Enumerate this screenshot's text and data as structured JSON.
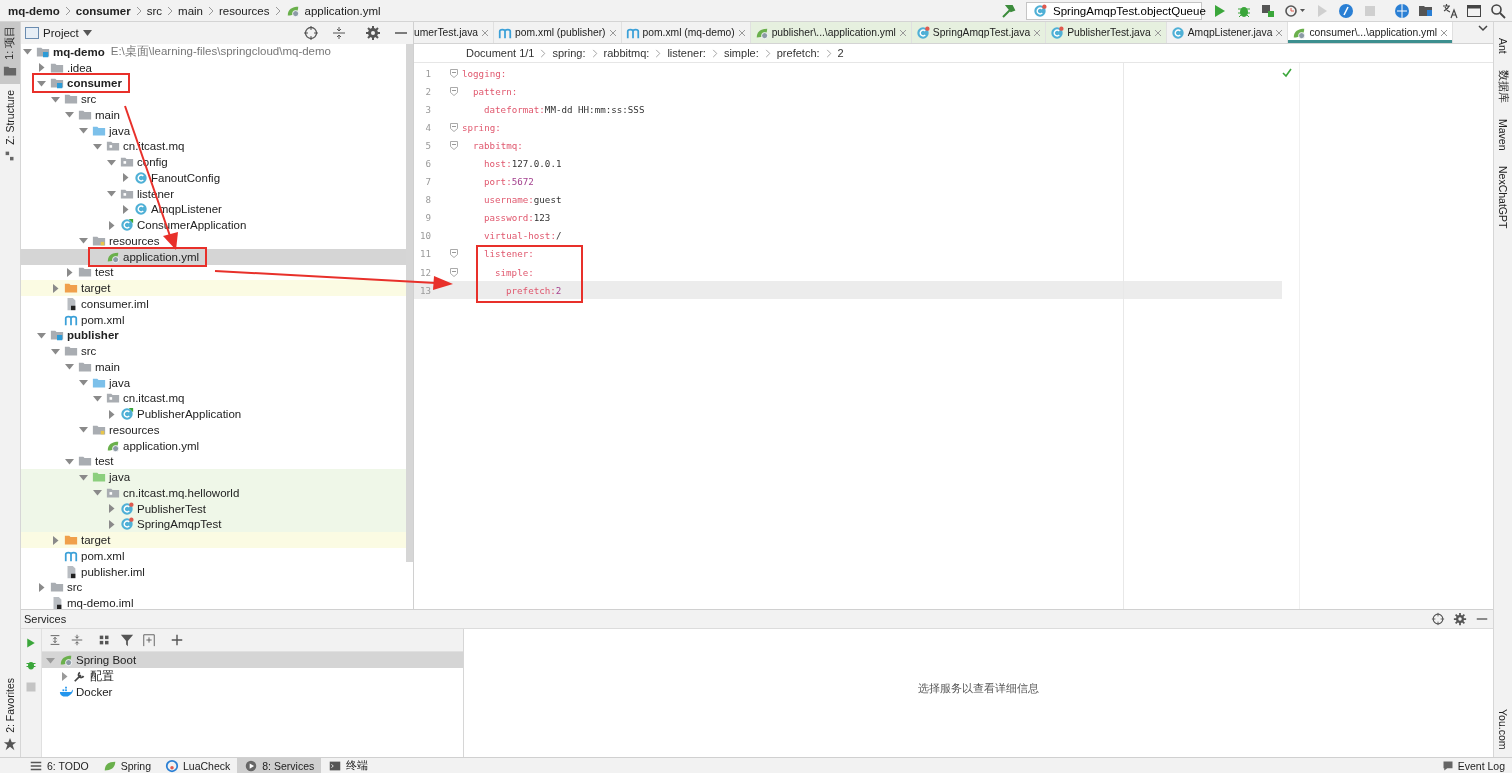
{
  "breadcrumbs": [
    {
      "label": "mq-demo",
      "kind": "module"
    },
    {
      "label": "consumer",
      "kind": "module"
    },
    {
      "label": "src",
      "kind": "folder"
    },
    {
      "label": "main",
      "kind": "folder"
    },
    {
      "label": "resources",
      "kind": "folder"
    },
    {
      "label": "application.yml",
      "kind": "file"
    }
  ],
  "run_config": {
    "label": "SpringAmqpTest.objectQueue"
  },
  "left_tool_tabs": [
    {
      "label": "1: 项目",
      "selected": true
    },
    {
      "label": "Z: Structure",
      "selected": false
    }
  ],
  "left_bottom_tool_tabs": [
    {
      "label": "2: Favorites",
      "selected": false
    }
  ],
  "right_tool_tabs": [
    {
      "label": "Ant"
    },
    {
      "label": "数据库"
    },
    {
      "label": "Maven"
    },
    {
      "label": "NexChatGPT"
    }
  ],
  "right_bottom_tool_tabs": [
    {
      "label": "You.com"
    }
  ],
  "project": {
    "title": "Project",
    "tree": [
      {
        "label": "mq-demo",
        "path": "E:\\桌面\\learning-files\\springcloud\\mq-demo",
        "kind": "module",
        "expanded": true,
        "selected": false,
        "highlighted": false,
        "children": [
          {
            "label": ".idea",
            "kind": "folder",
            "expanded": false,
            "selected": false,
            "highlighted": false
          },
          {
            "label": "consumer",
            "kind": "module",
            "expanded": true,
            "selected": false,
            "highlighted": true,
            "children": [
              {
                "label": "src",
                "kind": "folder",
                "expanded": true,
                "selected": false,
                "highlighted": false,
                "children": [
                  {
                    "label": "main",
                    "kind": "folder",
                    "expanded": true,
                    "selected": false,
                    "highlighted": false,
                    "children": [
                      {
                        "label": "java",
                        "kind": "source-root",
                        "expanded": true,
                        "selected": false,
                        "highlighted": false,
                        "children": [
                          {
                            "label": "cn.itcast.mq",
                            "kind": "package",
                            "expanded": true,
                            "selected": false,
                            "highlighted": false,
                            "children": [
                              {
                                "label": "config",
                                "kind": "package",
                                "expanded": true,
                                "selected": false,
                                "highlighted": false,
                                "children": [
                                  {
                                    "label": "FanoutConfig",
                                    "kind": "class",
                                    "expanded": false,
                                    "selected": false,
                                    "highlighted": false
                                  }
                                ]
                              },
                              {
                                "label": "listener",
                                "kind": "package",
                                "expanded": true,
                                "selected": false,
                                "highlighted": false,
                                "children": [
                                  {
                                    "label": "AmqpListener",
                                    "kind": "class",
                                    "expanded": false,
                                    "selected": false,
                                    "highlighted": false
                                  }
                                ]
                              },
                              {
                                "label": "ConsumerApplication",
                                "kind": "app-class",
                                "expanded": false,
                                "selected": false,
                                "highlighted": false
                              }
                            ]
                          }
                        ]
                      },
                      {
                        "label": "resources",
                        "kind": "resources",
                        "expanded": true,
                        "selected": false,
                        "highlighted": false,
                        "children": [
                          {
                            "label": "application.yml",
                            "kind": "yml",
                            "selected": true,
                            "highlighted": true
                          }
                        ]
                      }
                    ]
                  },
                  {
                    "label": "test",
                    "kind": "folder",
                    "expanded": false,
                    "selected": false,
                    "highlighted": false
                  }
                ]
              },
              {
                "label": "target",
                "kind": "excluded",
                "expanded": false,
                "selected": false,
                "highlighted": false
              },
              {
                "label": "consumer.iml",
                "kind": "iml",
                "selected": false,
                "highlighted": false
              },
              {
                "label": "pom.xml",
                "kind": "pom",
                "selected": false,
                "highlighted": false
              }
            ]
          },
          {
            "label": "publisher",
            "kind": "module",
            "expanded": true,
            "selected": false,
            "highlighted": false,
            "children": [
              {
                "label": "src",
                "kind": "folder",
                "expanded": true,
                "selected": false,
                "highlighted": false,
                "children": [
                  {
                    "label": "main",
                    "kind": "folder",
                    "expanded": true,
                    "selected": false,
                    "highlighted": false,
                    "children": [
                      {
                        "label": "java",
                        "kind": "source-root",
                        "expanded": true,
                        "selected": false,
                        "highlighted": false,
                        "children": [
                          {
                            "label": "cn.itcast.mq",
                            "kind": "package",
                            "expanded": true,
                            "selected": false,
                            "highlighted": false,
                            "children": [
                              {
                                "label": "PublisherApplication",
                                "kind": "app-class",
                                "expanded": false,
                                "selected": false,
                                "highlighted": false
                              }
                            ]
                          }
                        ]
                      },
                      {
                        "label": "resources",
                        "kind": "resources",
                        "expanded": true,
                        "selected": false,
                        "highlighted": false,
                        "children": [
                          {
                            "label": "application.yml",
                            "kind": "yml",
                            "selected": false,
                            "highlighted": false
                          }
                        ]
                      }
                    ]
                  },
                  {
                    "label": "test",
                    "kind": "folder",
                    "expanded": true,
                    "selected": false,
                    "highlighted": false,
                    "children": [
                      {
                        "label": "java",
                        "kind": "test-root",
                        "expanded": true,
                        "selected": false,
                        "highlighted": false,
                        "children": [
                          {
                            "label": "cn.itcast.mq.helloworld",
                            "kind": "test-package",
                            "expanded": true,
                            "selected": false,
                            "highlighted": false,
                            "children": [
                              {
                                "label": "PublisherTest",
                                "kind": "test-class",
                                "expanded": false,
                                "selected": false,
                                "highlighted": false
                              },
                              {
                                "label": "SpringAmqpTest",
                                "kind": "test-class",
                                "expanded": false,
                                "selected": false,
                                "highlighted": false
                              }
                            ]
                          }
                        ]
                      }
                    ]
                  }
                ]
              },
              {
                "label": "target",
                "kind": "excluded",
                "expanded": false,
                "selected": false,
                "highlighted": false
              },
              {
                "label": "pom.xml",
                "kind": "pom",
                "selected": false,
                "highlighted": false
              },
              {
                "label": "publisher.iml",
                "kind": "iml",
                "selected": false,
                "highlighted": false
              }
            ]
          },
          {
            "label": "src",
            "kind": "folder",
            "expanded": false,
            "selected": false,
            "highlighted": false
          },
          {
            "label": "mq-demo.iml",
            "kind": "iml",
            "selected": false,
            "highlighted": false
          }
        ]
      }
    ]
  },
  "editor": {
    "tabs": [
      {
        "label": "umerTest.java",
        "kind": "plain",
        "selected": false,
        "test": false
      },
      {
        "label": "pom.xml (publisher)",
        "kind": "pom",
        "selected": false,
        "test": false
      },
      {
        "label": "pom.xml (mq-demo)",
        "kind": "pom",
        "selected": false,
        "test": false
      },
      {
        "label": "publisher\\...\\application.yml",
        "kind": "yml",
        "selected": false,
        "test": true
      },
      {
        "label": "SpringAmqpTest.java",
        "kind": "test-class",
        "selected": false,
        "test": true
      },
      {
        "label": "PublisherTest.java",
        "kind": "test-class",
        "selected": false,
        "test": true
      },
      {
        "label": "AmqpListener.java",
        "kind": "class",
        "selected": false,
        "test": false
      },
      {
        "label": "consumer\\...\\application.yml",
        "kind": "yml",
        "selected": true,
        "test": false
      }
    ],
    "breadcrumbs": [
      "Document 1/1",
      "spring:",
      "rabbitmq:",
      "listener:",
      "simple:",
      "prefetch:",
      "2"
    ],
    "lines": [
      {
        "line": "1",
        "key": "logging:",
        "current": false,
        "highlighted": false,
        "children": [
          {
            "line": "2",
            "key": "pattern:",
            "current": false,
            "highlighted": false,
            "children": [
              {
                "line": "3",
                "key": "dateformat:",
                "value": "MM-dd HH:mm:ss:SSS",
                "kind": "string",
                "current": false,
                "highlighted": false
              }
            ]
          }
        ]
      },
      {
        "line": "4",
        "key": "spring:",
        "current": false,
        "highlighted": false,
        "children": [
          {
            "line": "5",
            "key": "rabbitmq:",
            "current": false,
            "highlighted": false,
            "children": [
              {
                "line": "6",
                "key": "host:",
                "value": "127.0.0.1",
                "kind": "string",
                "current": false,
                "highlighted": false
              },
              {
                "line": "7",
                "key": "port:",
                "value": "5672",
                "kind": "number",
                "current": false,
                "highlighted": false
              },
              {
                "line": "8",
                "key": "username:",
                "value": "guest",
                "kind": "string",
                "current": false,
                "highlighted": false
              },
              {
                "line": "9",
                "key": "password:",
                "value": "123",
                "kind": "string",
                "current": false,
                "highlighted": false
              },
              {
                "line": "10",
                "key": "virtual-host:",
                "value": "/",
                "kind": "string",
                "current": false,
                "highlighted": false
              },
              {
                "line": "11",
                "key": "listener:",
                "current": false,
                "highlighted": true,
                "children": [
                  {
                    "line": "12",
                    "key": "simple:",
                    "current": false,
                    "highlighted": false,
                    "children": [
                      {
                        "line": "13",
                        "key": "prefetch:",
                        "value": "2",
                        "kind": "number",
                        "current": true,
                        "highlighted": false
                      }
                    ]
                  }
                ]
              }
            ]
          }
        ]
      }
    ]
  },
  "services": {
    "title": "Services",
    "tree": [
      {
        "label": "Spring Boot",
        "kind": "spring-boot",
        "expanded": true,
        "selected": true,
        "children": [
          {
            "label": "配置",
            "kind": "wrench",
            "expanded": false,
            "selected": false
          }
        ]
      },
      {
        "label": "Docker",
        "kind": "docker",
        "selected": false
      }
    ],
    "empty_text": "选择服务以查看详细信息"
  },
  "status_bar": {
    "tabs": [
      {
        "label": "6: TODO",
        "kind": "list",
        "selected": false
      },
      {
        "label": "Spring",
        "kind": "leaf",
        "selected": false
      },
      {
        "label": "LuaCheck",
        "kind": "luacheck",
        "selected": false
      },
      {
        "label": "8: Services",
        "kind": "services",
        "selected": true
      },
      {
        "label": "终端",
        "kind": "terminal",
        "selected": false
      }
    ],
    "event_log": "Event Log"
  }
}
